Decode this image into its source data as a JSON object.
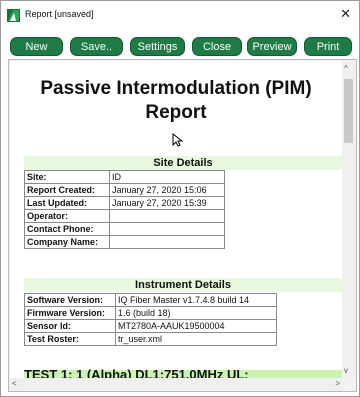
{
  "window": {
    "title": "Report [unsaved]",
    "close_glyph": "✕",
    "accent": "#1e7b45",
    "app_icon": "app-logo-icon"
  },
  "toolbar": {
    "buttons": [
      {
        "label": "New"
      },
      {
        "label": "Save.."
      },
      {
        "label": "Settings"
      },
      {
        "label": "Close"
      },
      {
        "label": "Preview"
      },
      {
        "label": "Print"
      }
    ]
  },
  "report": {
    "title_line1": "Passive Intermodulation (PIM)",
    "title_line2": "Report",
    "site_details": {
      "heading": "Site Details",
      "rows": [
        {
          "key": "Site:",
          "value": "ID"
        },
        {
          "key": "Report Created:",
          "value": "January 27, 2020 15:06"
        },
        {
          "key": "Last Updated:",
          "value": "January 27, 2020 15:39"
        },
        {
          "key": "Operator:",
          "value": ""
        },
        {
          "key": "Contact Phone:",
          "value": ""
        },
        {
          "key": "Company Name:",
          "value": ""
        }
      ]
    },
    "instrument_details": {
      "heading": "Instrument Details",
      "rows": [
        {
          "key": "Software Version:",
          "value": "IQ Fiber Master v1.7.4.8 build 14"
        },
        {
          "key": "Firmware Version:",
          "value": "1.6 (build 18)"
        },
        {
          "key": "Sensor Id:",
          "value": "MT2780A-AAUK19500004"
        },
        {
          "key": "Test Roster:",
          "value": "tr_user.xml"
        }
      ]
    },
    "test_heading": "TEST 1: 1 (Alpha) DL1:751.0MHz UL:"
  },
  "scrollbars": {
    "up": "^",
    "down": "v",
    "left": "<",
    "right": ">"
  }
}
